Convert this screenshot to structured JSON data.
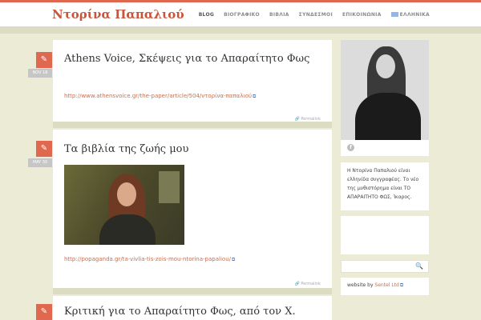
{
  "header": {
    "site_title": "Ντορίνα Παπαλιού",
    "nav": [
      {
        "label": "BLOG",
        "active": true
      },
      {
        "label": "ΒΙΟΓΡΑΦΙΚΟ"
      },
      {
        "label": "ΒΙΒΛΙΑ"
      },
      {
        "label": "ΣΥΝΔΕΣΜΟΙ"
      },
      {
        "label": "ΕΠΙΚΟΙΝΩΝΙΑ"
      },
      {
        "label": "ΕΛΛΗΝΙΚΑ",
        "icon": "greek-flag-icon"
      }
    ]
  },
  "posts": [
    {
      "date": "NOV 18",
      "title": "Athens Voice, Σκέψεις για το Απαραίτητο Φως",
      "link": "http://www.athensvoice.gr/the-paper/article/504/ντορίνα-παπαλιού",
      "permalink": "Permalink"
    },
    {
      "date": "MAY 30",
      "title": "Τα βιβλία της ζωής μου",
      "link": "http://popaganda.gr/ta-vivlia-tis-zois-mou-ntorina-papaliou/",
      "permalink": "Permalink"
    },
    {
      "title": "Κριτική για το Απαραίτητο Φως, από τον Χ."
    }
  ],
  "sidebar": {
    "bio": "Η Ντορίνα Παπαλιού είναι ελληνίδα συγγραφέας. Το νέο της μυθιστόρημα είναι ΤΟ ΑΠΑΡΑΙΤΗΤΟ ΦΩΣ, Ίκαρος.",
    "facebook_icon_label": "f",
    "credit_prefix": "website by ",
    "credit_link": "Sentel Ltd"
  },
  "icons": {
    "edit": "✎",
    "external": "⧉",
    "search": "🔍",
    "permalink": "🔗"
  },
  "colors": {
    "accent": "#e0684f",
    "background": "#ecebd6",
    "link": "#c8704f"
  }
}
